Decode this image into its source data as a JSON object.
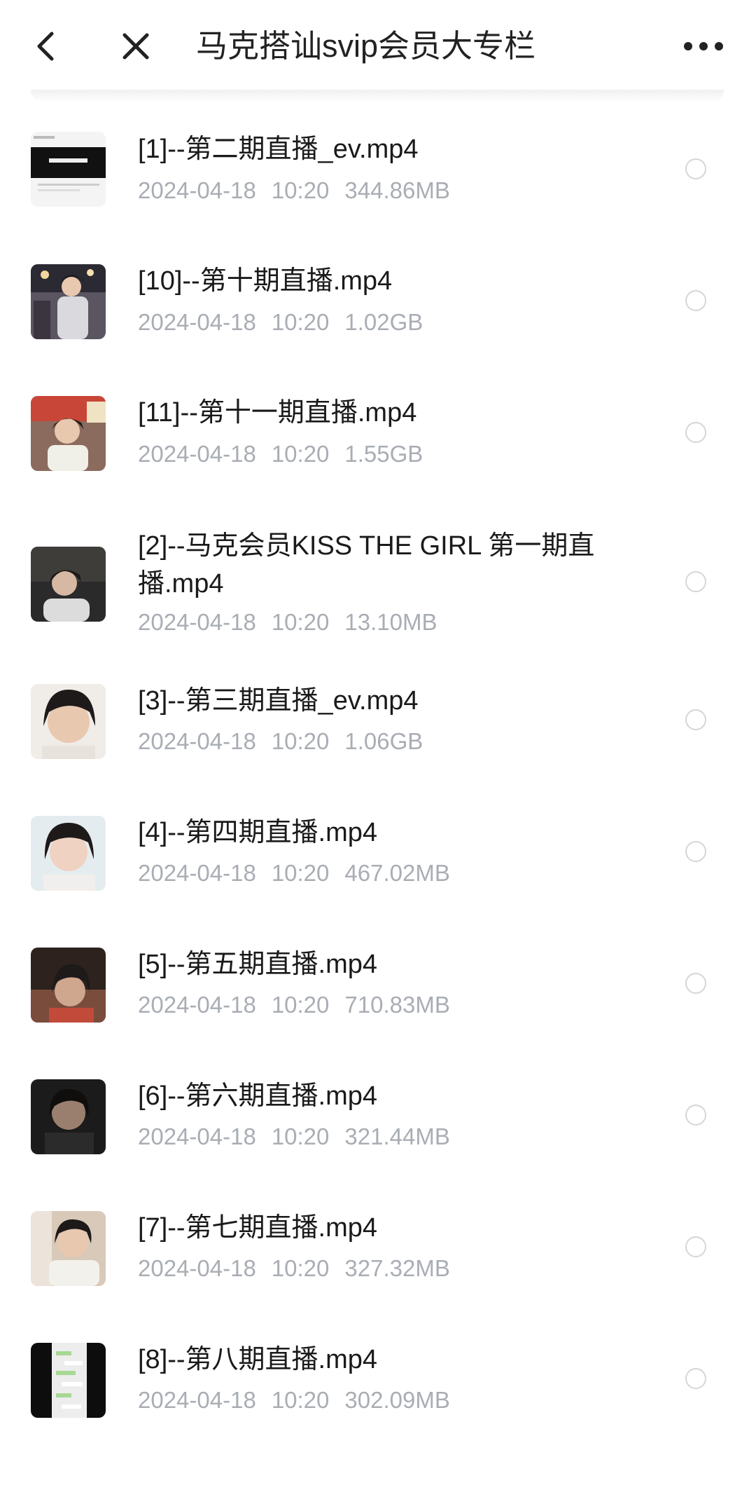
{
  "header": {
    "title": "马克搭讪svip会员大专栏",
    "back_icon": "back-icon",
    "close_icon": "close-icon",
    "more_icon": "more-icon"
  },
  "files": [
    {
      "name": "[1]--第二期直播_ev.mp4",
      "date": "2024-04-18",
      "time": "10:20",
      "size": "344.86MB",
      "thumb_type": "screenshot"
    },
    {
      "name": "[10]--第十期直播.mp4",
      "date": "2024-04-18",
      "time": "10:20",
      "size": "1.02GB",
      "thumb_type": "street"
    },
    {
      "name": "[11]--第十一期直播.mp4",
      "date": "2024-04-18",
      "time": "10:20",
      "size": "1.55GB",
      "thumb_type": "street-red"
    },
    {
      "name": "[2]--马克会员KISS THE GIRL 第一期直播.mp4",
      "date": "2024-04-18",
      "time": "10:20",
      "size": "13.10MB",
      "thumb_type": "dark-car"
    },
    {
      "name": "[3]--第三期直播_ev.mp4",
      "date": "2024-04-18",
      "time": "10:20",
      "size": "1.06GB",
      "thumb_type": "face-close"
    },
    {
      "name": "[4]--第四期直播.mp4",
      "date": "2024-04-18",
      "time": "10:20",
      "size": "467.02MB",
      "thumb_type": "face-light"
    },
    {
      "name": "[5]--第五期直播.mp4",
      "date": "2024-04-18",
      "time": "10:20",
      "size": "710.83MB",
      "thumb_type": "dark-room"
    },
    {
      "name": "[6]--第六期直播.mp4",
      "date": "2024-04-18",
      "time": "10:20",
      "size": "321.44MB",
      "thumb_type": "dark-face"
    },
    {
      "name": "[7]--第七期直播.mp4",
      "date": "2024-04-18",
      "time": "10:20",
      "size": "327.32MB",
      "thumb_type": "room-smile"
    },
    {
      "name": "[8]--第八期直播.mp4",
      "date": "2024-04-18",
      "time": "10:20",
      "size": "302.09MB",
      "thumb_type": "chat-screen"
    }
  ],
  "colors": {
    "text_primary": "#1a1a1a",
    "text_secondary": "#a9adb4",
    "radio_border": "#d6d6d6"
  }
}
